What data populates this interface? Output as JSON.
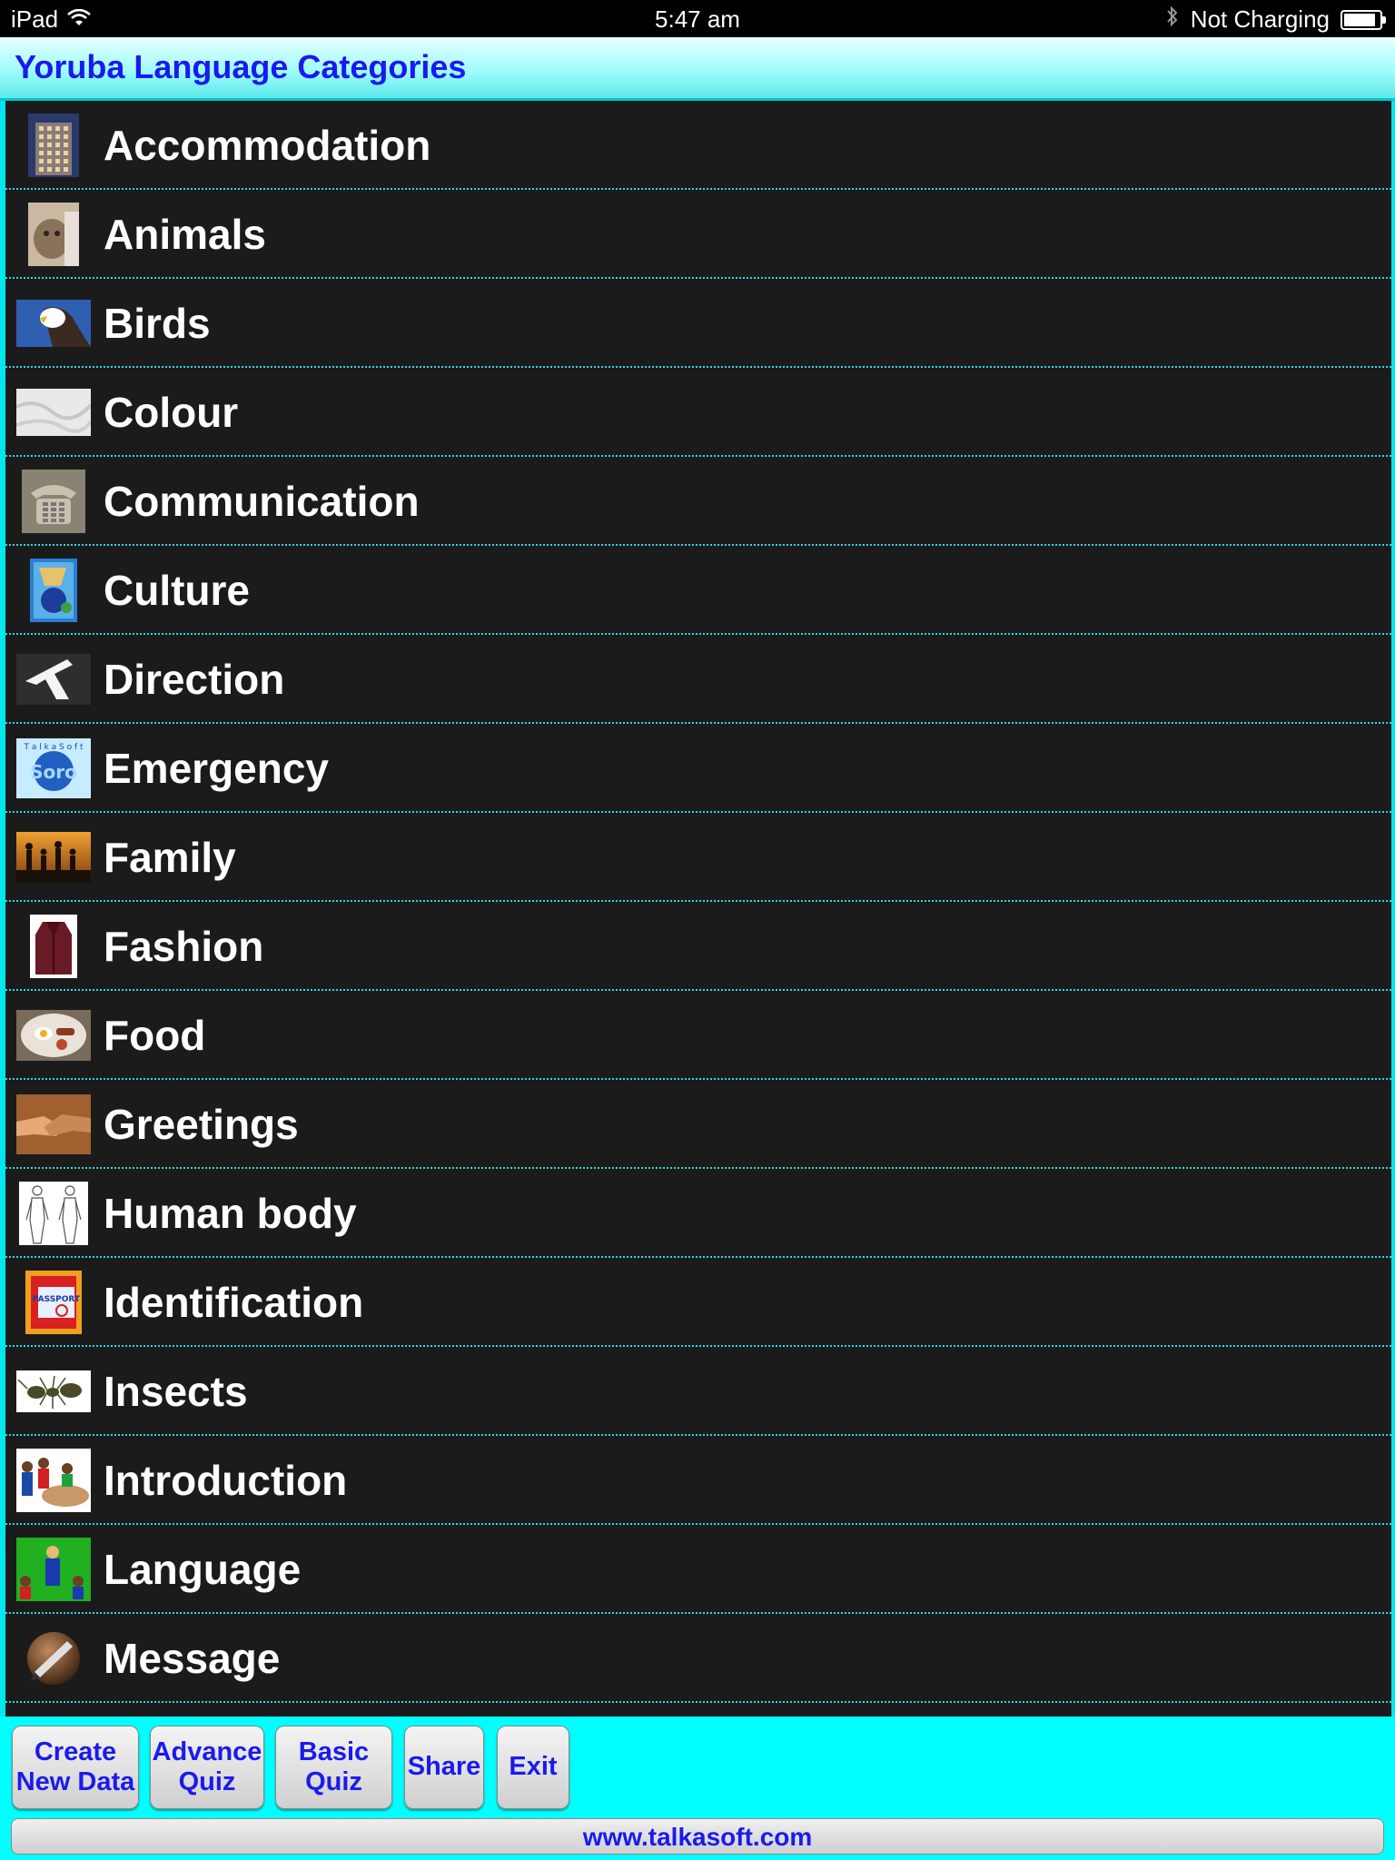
{
  "status_bar": {
    "device": "iPad",
    "time": "5:47 am",
    "charging": "Not Charging",
    "battery_level": 0.9
  },
  "header": {
    "title": "Yoruba Language Categories"
  },
  "categories": [
    {
      "label": "Accommodation",
      "icon": "hotel-building-icon"
    },
    {
      "label": "Animals",
      "icon": "cat-icon"
    },
    {
      "label": "Birds",
      "icon": "eagle-icon"
    },
    {
      "label": "Colour",
      "icon": "white-fabric-icon"
    },
    {
      "label": "Communication",
      "icon": "telephone-icon"
    },
    {
      "label": "Culture",
      "icon": "culture-poster-icon"
    },
    {
      "label": "Direction",
      "icon": "arrow-sign-icon"
    },
    {
      "label": "Emergency",
      "icon": "talkasoft-logo-icon"
    },
    {
      "label": "Family",
      "icon": "family-silhouette-icon"
    },
    {
      "label": "Fashion",
      "icon": "leather-jacket-icon"
    },
    {
      "label": "Food",
      "icon": "breakfast-plate-icon"
    },
    {
      "label": "Greetings",
      "icon": "handshake-icon"
    },
    {
      "label": "Human body",
      "icon": "body-outline-icon"
    },
    {
      "label": "Identification",
      "icon": "passport-icon"
    },
    {
      "label": "Insects",
      "icon": "ant-icon"
    },
    {
      "label": "Introduction",
      "icon": "people-meeting-icon"
    },
    {
      "label": "Language",
      "icon": "classroom-icon"
    },
    {
      "label": "Message",
      "icon": "pen-icon"
    }
  ],
  "toolbar": {
    "create": "Create\nNew Data",
    "advance": "Advance\nQuiz",
    "basic": "Basic\nQuiz",
    "share": "Share",
    "exit": "Exit",
    "website": "www.talkasoft.com"
  }
}
